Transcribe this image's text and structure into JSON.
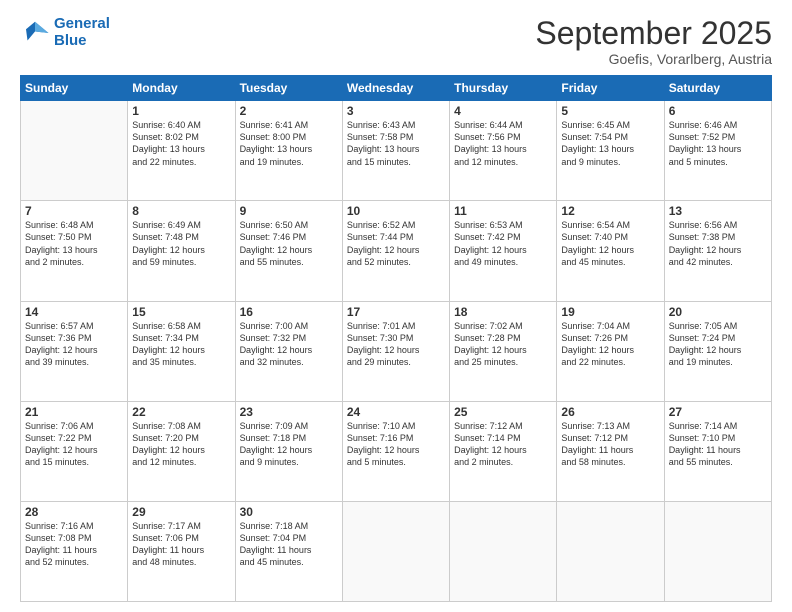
{
  "logo": {
    "line1": "General",
    "line2": "Blue"
  },
  "title": "September 2025",
  "subtitle": "Goefis, Vorarlberg, Austria",
  "headers": [
    "Sunday",
    "Monday",
    "Tuesday",
    "Wednesday",
    "Thursday",
    "Friday",
    "Saturday"
  ],
  "rows": [
    [
      {
        "day": "",
        "info": ""
      },
      {
        "day": "1",
        "info": "Sunrise: 6:40 AM\nSunset: 8:02 PM\nDaylight: 13 hours\nand 22 minutes."
      },
      {
        "day": "2",
        "info": "Sunrise: 6:41 AM\nSunset: 8:00 PM\nDaylight: 13 hours\nand 19 minutes."
      },
      {
        "day": "3",
        "info": "Sunrise: 6:43 AM\nSunset: 7:58 PM\nDaylight: 13 hours\nand 15 minutes."
      },
      {
        "day": "4",
        "info": "Sunrise: 6:44 AM\nSunset: 7:56 PM\nDaylight: 13 hours\nand 12 minutes."
      },
      {
        "day": "5",
        "info": "Sunrise: 6:45 AM\nSunset: 7:54 PM\nDaylight: 13 hours\nand 9 minutes."
      },
      {
        "day": "6",
        "info": "Sunrise: 6:46 AM\nSunset: 7:52 PM\nDaylight: 13 hours\nand 5 minutes."
      }
    ],
    [
      {
        "day": "7",
        "info": "Sunrise: 6:48 AM\nSunset: 7:50 PM\nDaylight: 13 hours\nand 2 minutes."
      },
      {
        "day": "8",
        "info": "Sunrise: 6:49 AM\nSunset: 7:48 PM\nDaylight: 12 hours\nand 59 minutes."
      },
      {
        "day": "9",
        "info": "Sunrise: 6:50 AM\nSunset: 7:46 PM\nDaylight: 12 hours\nand 55 minutes."
      },
      {
        "day": "10",
        "info": "Sunrise: 6:52 AM\nSunset: 7:44 PM\nDaylight: 12 hours\nand 52 minutes."
      },
      {
        "day": "11",
        "info": "Sunrise: 6:53 AM\nSunset: 7:42 PM\nDaylight: 12 hours\nand 49 minutes."
      },
      {
        "day": "12",
        "info": "Sunrise: 6:54 AM\nSunset: 7:40 PM\nDaylight: 12 hours\nand 45 minutes."
      },
      {
        "day": "13",
        "info": "Sunrise: 6:56 AM\nSunset: 7:38 PM\nDaylight: 12 hours\nand 42 minutes."
      }
    ],
    [
      {
        "day": "14",
        "info": "Sunrise: 6:57 AM\nSunset: 7:36 PM\nDaylight: 12 hours\nand 39 minutes."
      },
      {
        "day": "15",
        "info": "Sunrise: 6:58 AM\nSunset: 7:34 PM\nDaylight: 12 hours\nand 35 minutes."
      },
      {
        "day": "16",
        "info": "Sunrise: 7:00 AM\nSunset: 7:32 PM\nDaylight: 12 hours\nand 32 minutes."
      },
      {
        "day": "17",
        "info": "Sunrise: 7:01 AM\nSunset: 7:30 PM\nDaylight: 12 hours\nand 29 minutes."
      },
      {
        "day": "18",
        "info": "Sunrise: 7:02 AM\nSunset: 7:28 PM\nDaylight: 12 hours\nand 25 minutes."
      },
      {
        "day": "19",
        "info": "Sunrise: 7:04 AM\nSunset: 7:26 PM\nDaylight: 12 hours\nand 22 minutes."
      },
      {
        "day": "20",
        "info": "Sunrise: 7:05 AM\nSunset: 7:24 PM\nDaylight: 12 hours\nand 19 minutes."
      }
    ],
    [
      {
        "day": "21",
        "info": "Sunrise: 7:06 AM\nSunset: 7:22 PM\nDaylight: 12 hours\nand 15 minutes."
      },
      {
        "day": "22",
        "info": "Sunrise: 7:08 AM\nSunset: 7:20 PM\nDaylight: 12 hours\nand 12 minutes."
      },
      {
        "day": "23",
        "info": "Sunrise: 7:09 AM\nSunset: 7:18 PM\nDaylight: 12 hours\nand 9 minutes."
      },
      {
        "day": "24",
        "info": "Sunrise: 7:10 AM\nSunset: 7:16 PM\nDaylight: 12 hours\nand 5 minutes."
      },
      {
        "day": "25",
        "info": "Sunrise: 7:12 AM\nSunset: 7:14 PM\nDaylight: 12 hours\nand 2 minutes."
      },
      {
        "day": "26",
        "info": "Sunrise: 7:13 AM\nSunset: 7:12 PM\nDaylight: 11 hours\nand 58 minutes."
      },
      {
        "day": "27",
        "info": "Sunrise: 7:14 AM\nSunset: 7:10 PM\nDaylight: 11 hours\nand 55 minutes."
      }
    ],
    [
      {
        "day": "28",
        "info": "Sunrise: 7:16 AM\nSunset: 7:08 PM\nDaylight: 11 hours\nand 52 minutes."
      },
      {
        "day": "29",
        "info": "Sunrise: 7:17 AM\nSunset: 7:06 PM\nDaylight: 11 hours\nand 48 minutes."
      },
      {
        "day": "30",
        "info": "Sunrise: 7:18 AM\nSunset: 7:04 PM\nDaylight: 11 hours\nand 45 minutes."
      },
      {
        "day": "",
        "info": ""
      },
      {
        "day": "",
        "info": ""
      },
      {
        "day": "",
        "info": ""
      },
      {
        "day": "",
        "info": ""
      }
    ]
  ]
}
